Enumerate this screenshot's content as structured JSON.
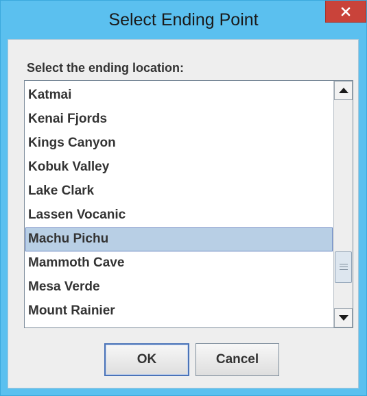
{
  "window": {
    "title": "Select Ending Point",
    "close_glyph": "×"
  },
  "dialog": {
    "prompt": "Select the ending location:",
    "items": [
      "Katmai",
      "Kenai Fjords",
      "Kings Canyon",
      "Kobuk Valley",
      "Lake Clark",
      "Lassen Vocanic",
      "Machu Pichu",
      "Mammoth Cave",
      "Mesa Verde",
      "Mount Rainier"
    ],
    "selected_index": 6,
    "ok_label": "OK",
    "cancel_label": "Cancel"
  },
  "colors": {
    "frame": "#5bc0ef",
    "close_button": "#c9433a",
    "selection": "#b8cfe5",
    "selection_border": "#6382bf"
  },
  "icons": {
    "close": "close-icon",
    "scroll_up": "scroll-up-arrow-icon",
    "scroll_down": "scroll-down-arrow-icon",
    "thumb_grip": "grip-icon"
  }
}
